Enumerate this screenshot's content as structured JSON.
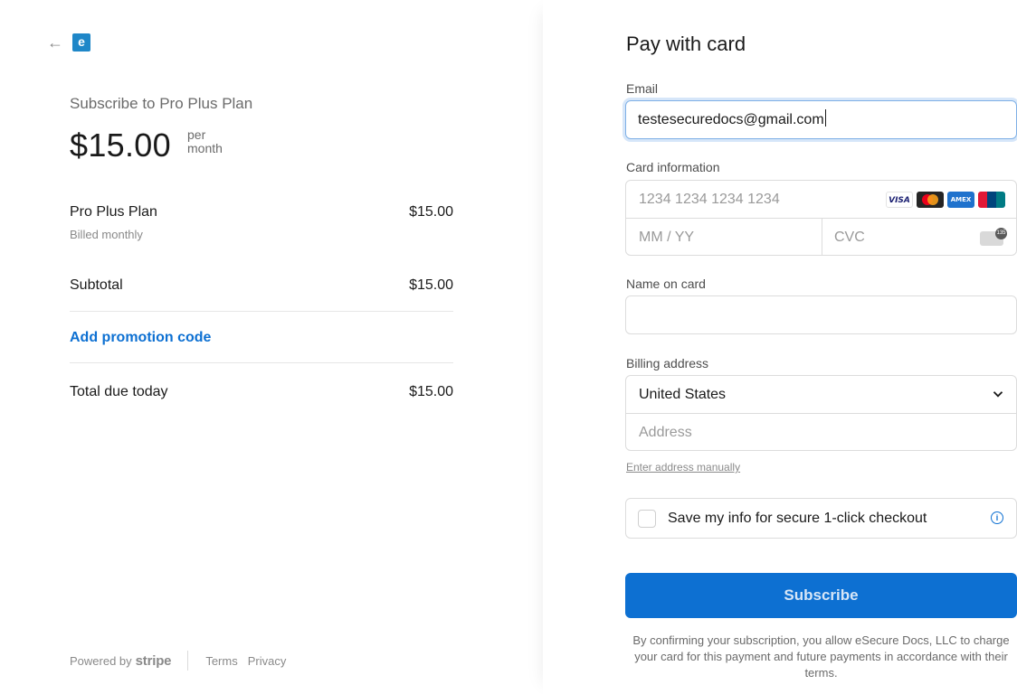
{
  "nav": {
    "back_icon": "arrow-left-icon",
    "logo_letter": "e"
  },
  "summary": {
    "title": "Subscribe to Pro Plus Plan",
    "price": "$15.00",
    "per_line1": "per",
    "per_line2": "month",
    "item_name": "Pro Plus Plan",
    "item_amount": "$15.00",
    "item_billing": "Billed monthly",
    "subtotal_label": "Subtotal",
    "subtotal_amount": "$15.00",
    "promo_label": "Add promotion code",
    "total_label": "Total due today",
    "total_amount": "$15.00"
  },
  "footer": {
    "powered_by": "Powered by",
    "stripe": "stripe",
    "terms": "Terms",
    "privacy": "Privacy"
  },
  "form": {
    "title": "Pay with card",
    "email_label": "Email",
    "email_value": "testesecuredocs@gmail.com",
    "card_label": "Card information",
    "card_number_placeholder": "1234 1234 1234 1234",
    "expiry_placeholder": "MM / YY",
    "cvc_placeholder": "CVC",
    "card_brands": [
      "VISA",
      "mastercard",
      "AMEX",
      "UnionPay"
    ],
    "name_label": "Name on card",
    "name_value": "",
    "billing_label": "Billing address",
    "country": "United States",
    "address_placeholder": "Address",
    "manual_link": "Enter address manually",
    "save_info_label": "Save my info for secure 1-click checkout",
    "save_info_checked": false,
    "subscribe_label": "Subscribe",
    "terms_text": "By confirming your subscription, you allow eSecure Docs, LLC to charge your card for this payment and future payments in accordance with their terms."
  },
  "colors": {
    "accent": "#0d70d2",
    "logo": "#1f87c8",
    "muted": "#8a8a8a"
  }
}
